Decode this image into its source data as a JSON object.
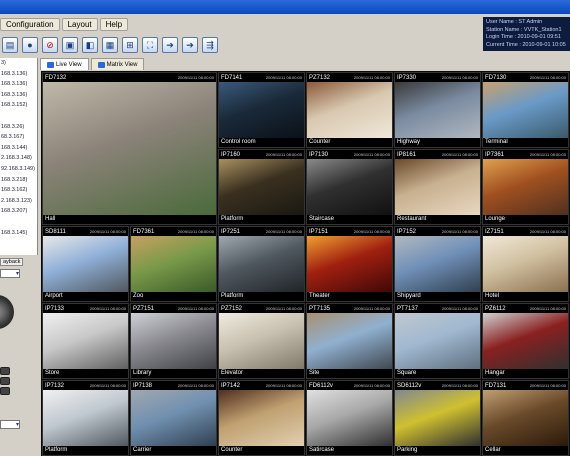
{
  "menu": [
    "Configuration",
    "Layout",
    "Help"
  ],
  "info": {
    "user_name": "User Name : ST Admin",
    "station_name": "Station Name : VVTK_Station1",
    "login_time": "Login Time : 2010-09-01 09:51",
    "current_time": "Current Time : 2010-09-01 10:05"
  },
  "tree": [
    "3)",
    "168.3.136)",
    "168.3.136)",
    "168.3.136)",
    "168.3.152)",
    "",
    "168.3.26)",
    "68.3.167)",
    "168.3.144)",
    "2.168.3.148)",
    "92.168.3.149)",
    "168.3.218)",
    "168.3.162)",
    "2.168.3.123)",
    "168.3.207)",
    "",
    "168.3.145)"
  ],
  "playback_label": "ayback",
  "tabs": [
    "Live View",
    "Matrix View"
  ],
  "cameras": [
    {
      "id": "FD7132",
      "name": "Hall",
      "ts": "2009/11/11 08:00:00",
      "big": true,
      "colors": [
        "#8a8278",
        "#c0b8a8",
        "#4a6a3a"
      ]
    },
    {
      "id": "FD7141",
      "name": "Control room",
      "ts": "2009/11/11 08:00:00",
      "colors": [
        "#1a2a3a",
        "#3a5a7a",
        "#0a1018"
      ]
    },
    {
      "id": "PZ7132",
      "name": "Counter",
      "ts": "2009/11/11 08:00:00",
      "colors": [
        "#d8c8b0",
        "#8a5a3a",
        "#f0e8d8"
      ]
    },
    {
      "id": "IP7330",
      "name": "Highway",
      "ts": "2009/11/11 08:00:00",
      "colors": [
        "#7a8aa0",
        "#3a3a3a",
        "#b0b8c0"
      ]
    },
    {
      "id": "FD7130",
      "name": "Terminal",
      "ts": "2009/11/11 08:00:00",
      "colors": [
        "#6a9ac8",
        "#c8a070",
        "#3a5a6a"
      ]
    },
    {
      "id": "IP7160",
      "name": "Platform",
      "ts": "2009/11/11 08:00:00",
      "colors": [
        "#3a3020",
        "#a89060",
        "#1a1810"
      ]
    },
    {
      "id": "IP7130",
      "name": "Staircase",
      "ts": "2009/11/11 08:00:00",
      "colors": [
        "#303030",
        "#8a8a8a",
        "#101010"
      ]
    },
    {
      "id": "IP8161",
      "name": "Restaurant",
      "ts": "2009/11/11 08:00:00",
      "colors": [
        "#c8b090",
        "#6a4a2a",
        "#e8d8c0"
      ]
    },
    {
      "id": "IP7361",
      "name": "Lounge",
      "ts": "2009/11/11 08:00:00",
      "colors": [
        "#a05020",
        "#e0a050",
        "#503020"
      ]
    },
    {
      "id": "SD8111",
      "name": "Airport",
      "ts": "2009/11/11 08:00:00",
      "colors": [
        "#90b0d8",
        "#e8e8e8",
        "#505860"
      ]
    },
    {
      "id": "FD7361",
      "name": "Zoo",
      "ts": "2009/11/11 08:00:00",
      "colors": [
        "#7a9a4a",
        "#c8a060",
        "#3a5a2a"
      ]
    },
    {
      "id": "IP7251",
      "name": "Platform",
      "ts": "2009/11/11 08:00:00",
      "colors": [
        "#505860",
        "#a0a8b0",
        "#202428"
      ]
    },
    {
      "id": "IP7151",
      "name": "Theater",
      "ts": "2009/11/11 08:00:00",
      "colors": [
        "#a02010",
        "#f0a030",
        "#400808"
      ]
    },
    {
      "id": "IP7152",
      "name": "Shipyard",
      "ts": "2009/11/11 08:00:00",
      "colors": [
        "#7090b8",
        "#b0b8c0",
        "#304050"
      ]
    },
    {
      "id": "IZ7151",
      "name": "Hotel",
      "ts": "2009/11/11 08:00:00",
      "colors": [
        "#d0c0a0",
        "#f0e8d8",
        "#8a7050"
      ]
    },
    {
      "id": "IP7133",
      "name": "Store",
      "ts": "2009/11/11 08:00:00",
      "colors": [
        "#c8c8c8",
        "#f0f0f0",
        "#606060"
      ]
    },
    {
      "id": "PZ7151",
      "name": "Library",
      "ts": "2009/11/11 08:00:00",
      "colors": [
        "#8a8a90",
        "#d0d0d8",
        "#404048"
      ]
    },
    {
      "id": "PZ7152",
      "name": "Elevator",
      "ts": "2009/11/11 08:00:00",
      "colors": [
        "#c8c0b0",
        "#f0ece0",
        "#807868"
      ]
    },
    {
      "id": "PT7135",
      "name": "Site",
      "ts": "2009/11/11 08:00:00",
      "colors": [
        "#90b0d0",
        "#a89070",
        "#404850"
      ]
    },
    {
      "id": "PT7137",
      "name": "Square",
      "ts": "2009/11/11 08:00:00",
      "colors": [
        "#a0b8d0",
        "#c0c8d0",
        "#607080"
      ]
    },
    {
      "id": "PZ6112",
      "name": "Hangar",
      "ts": "2009/11/11 08:00:00",
      "colors": [
        "#8a2020",
        "#d0d0d0",
        "#303030"
      ]
    },
    {
      "id": "IP7132",
      "name": "Platform",
      "ts": "2009/11/11 08:00:00",
      "colors": [
        "#c0c8d0",
        "#f0f0f0",
        "#505860"
      ]
    },
    {
      "id": "IP7138",
      "name": "Carrier",
      "ts": "2009/11/11 08:00:00",
      "colors": [
        "#7090b0",
        "#a0a8b0",
        "#304050"
      ]
    },
    {
      "id": "IP7142",
      "name": "Counter",
      "ts": "2009/11/11 08:00:00",
      "colors": [
        "#c0a070",
        "#503020",
        "#e0d0b0"
      ]
    },
    {
      "id": "FD6112v",
      "name": "Satircase",
      "ts": "2009/11/11 08:00:00",
      "colors": [
        "#a8a8a8",
        "#e0e0e0",
        "#303030"
      ]
    },
    {
      "id": "SD6112v",
      "name": "Parking",
      "ts": "2009/11/11 08:00:00",
      "colors": [
        "#d0c030",
        "#808890",
        "#303030"
      ]
    },
    {
      "id": "FD7131",
      "name": "Cellar",
      "ts": "2009/11/11 08:00:00",
      "colors": [
        "#6a4a2a",
        "#c0a070",
        "#2a1a0a"
      ]
    }
  ]
}
